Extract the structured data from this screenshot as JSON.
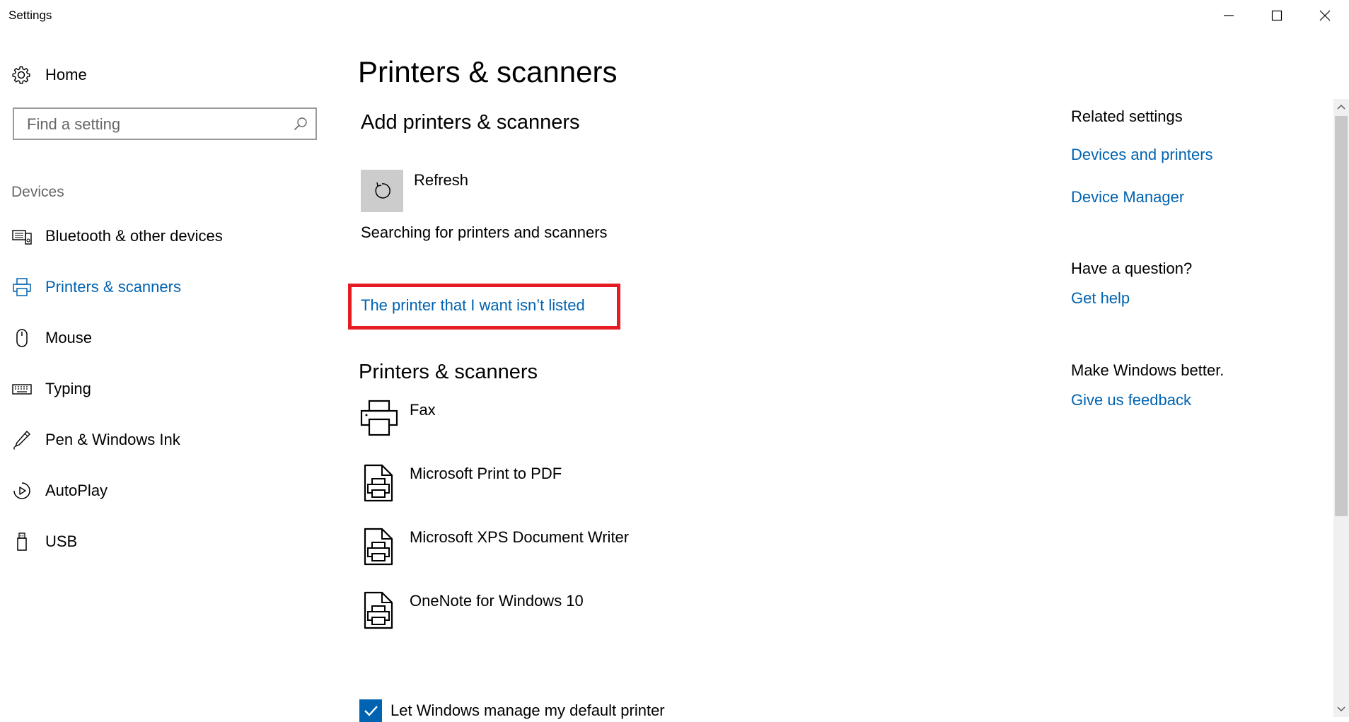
{
  "window": {
    "title": "Settings"
  },
  "sidebar": {
    "home_label": "Home",
    "search_placeholder": "Find a setting",
    "section_label": "Devices",
    "items": [
      {
        "label": "Bluetooth & other devices",
        "icon": "bluetooth-devices-icon"
      },
      {
        "label": "Printers & scanners",
        "icon": "printer-icon",
        "active": true
      },
      {
        "label": "Mouse",
        "icon": "mouse-icon"
      },
      {
        "label": "Typing",
        "icon": "keyboard-icon"
      },
      {
        "label": "Pen & Windows Ink",
        "icon": "pen-icon"
      },
      {
        "label": "AutoPlay",
        "icon": "autoplay-icon"
      },
      {
        "label": "USB",
        "icon": "usb-icon"
      }
    ]
  },
  "main": {
    "title": "Printers & scanners",
    "add_section_title": "Add printers & scanners",
    "refresh_label": "Refresh",
    "searching_text": "Searching for printers and scanners",
    "not_listed_link": "The printer that I want isn’t listed",
    "list_section_title": "Printers & scanners",
    "devices": [
      {
        "label": "Fax",
        "icon": "fax-icon"
      },
      {
        "label": "Microsoft Print to PDF",
        "icon": "print-document-icon"
      },
      {
        "label": "Microsoft XPS Document Writer",
        "icon": "print-document-icon"
      },
      {
        "label": "OneNote for Windows 10",
        "icon": "print-document-icon"
      }
    ],
    "default_printer_checkbox": {
      "label": "Let Windows manage my default printer",
      "checked": true
    }
  },
  "related": {
    "heading": "Related settings",
    "links": [
      "Devices and printers",
      "Device Manager"
    ],
    "question_heading": "Have a question?",
    "help_link": "Get help",
    "feedback_heading": "Make Windows better.",
    "feedback_link": "Give us feedback"
  },
  "colors": {
    "accent": "#0063b1",
    "highlight": "#e51c23",
    "button_bg": "#cccccc"
  }
}
